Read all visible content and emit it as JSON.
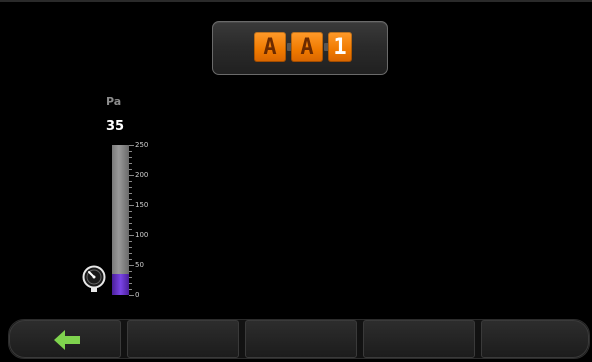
{
  "display": {
    "tiles": [
      "A",
      "A",
      "1"
    ]
  },
  "gauge": {
    "unit": "Pa",
    "value": "35",
    "reading": 35,
    "min": 0,
    "max": 250,
    "ticks": [
      "250",
      "200",
      "150",
      "100",
      "50",
      "0"
    ],
    "fill_color": "#7a44e6",
    "icon": "pressure-gauge-icon"
  },
  "toolbar": {
    "buttons": [
      {
        "name": "back",
        "icon": "back-arrow-icon",
        "color": "#7fd34e"
      },
      {
        "name": "empty-2"
      },
      {
        "name": "empty-3"
      },
      {
        "name": "empty-4"
      },
      {
        "name": "empty-5"
      }
    ]
  }
}
